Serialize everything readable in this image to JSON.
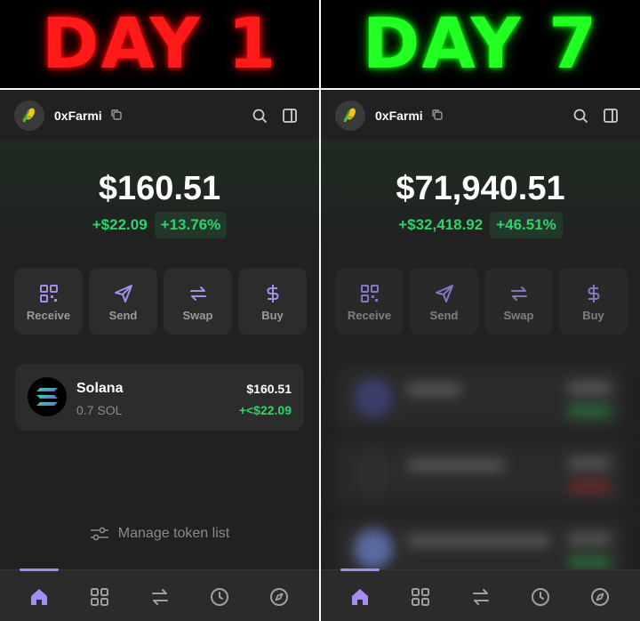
{
  "banners": {
    "left": "DAY 1",
    "right": "DAY 7"
  },
  "day1": {
    "username": "0xFarmi",
    "balance": "$160.51",
    "change_abs": "+$22.09",
    "change_pct": "+13.76%",
    "actions": [
      {
        "label": "Receive",
        "icon": "qr-code-icon"
      },
      {
        "label": "Send",
        "icon": "send-icon"
      },
      {
        "label": "Swap",
        "icon": "swap-icon"
      },
      {
        "label": "Buy",
        "icon": "dollar-icon"
      }
    ],
    "token": {
      "name": "Solana",
      "amount": "0.7 SOL",
      "value": "$160.51",
      "change": "+<$22.09"
    },
    "manage_label": "Manage token list"
  },
  "day7": {
    "username": "0xFarmi",
    "balance": "$71,940.51",
    "change_abs": "+$32,418.92",
    "change_pct": "+46.51%",
    "actions": [
      {
        "label": "Receive",
        "icon": "qr-code-icon"
      },
      {
        "label": "Send",
        "icon": "send-icon"
      },
      {
        "label": "Swap",
        "icon": "swap-icon"
      },
      {
        "label": "Buy",
        "icon": "dollar-icon"
      }
    ]
  },
  "nav_icons": [
    "home-icon",
    "grid-icon",
    "swap-icon",
    "history-icon",
    "explore-icon"
  ],
  "colors": {
    "accent": "#a48cf0",
    "positive": "#2fd36a",
    "day1_banner": "#ff1a1a",
    "day7_banner": "#22ff22",
    "background": "#212121"
  }
}
